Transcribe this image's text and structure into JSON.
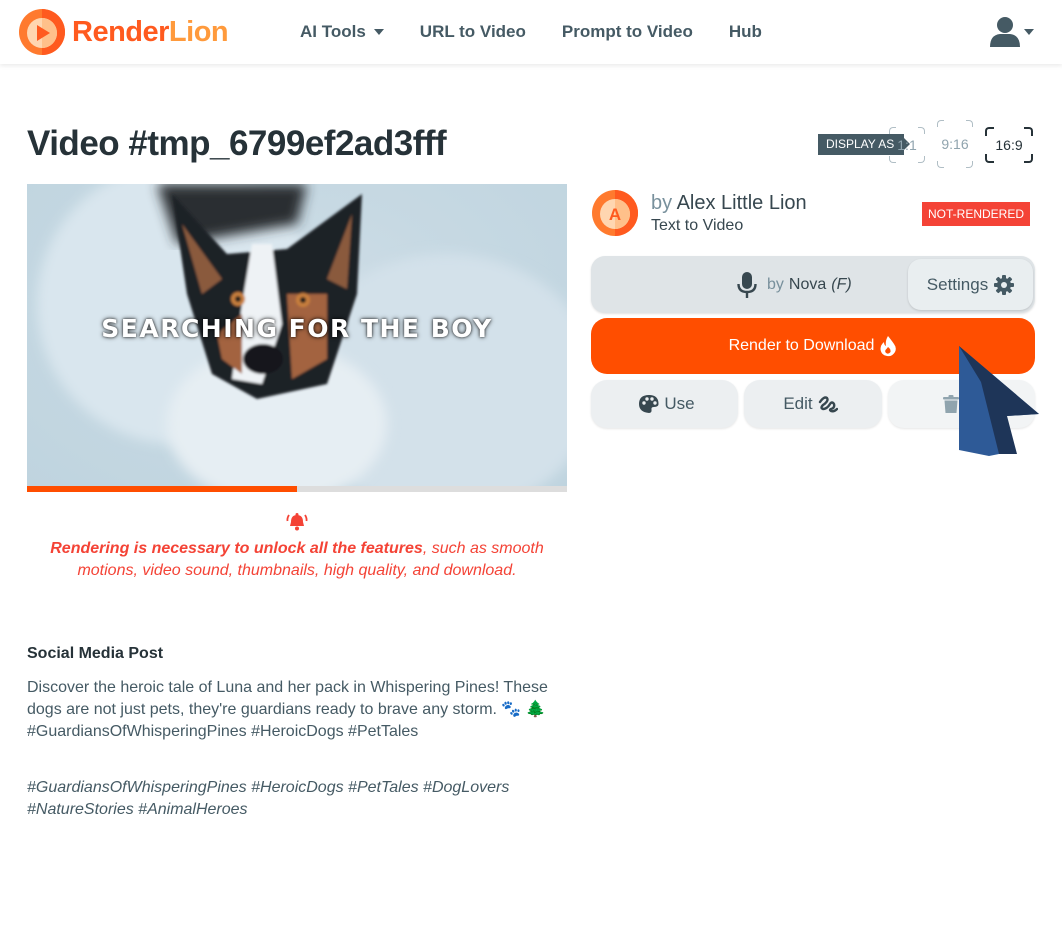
{
  "brand": {
    "name_part1": "Render",
    "name_part2": "Lion",
    "primary_color": "#ff4e00"
  },
  "nav": {
    "items": [
      {
        "label": "AI Tools",
        "has_dropdown": true
      },
      {
        "label": "URL to Video"
      },
      {
        "label": "Prompt to Video"
      },
      {
        "label": "Hub"
      }
    ],
    "user_icon": "user-icon"
  },
  "page": {
    "title": "Video #tmp_6799ef2ad3fff",
    "display_as_label": "DISPLAY AS",
    "ratios": [
      {
        "label": "1:1",
        "active": false
      },
      {
        "label": "9:16",
        "active": false
      },
      {
        "label": "16:9",
        "active": true
      }
    ]
  },
  "video": {
    "caption": "SEARCHING FOR THE BOY",
    "progress_percent": 50
  },
  "notice": {
    "icon": "bell-icon",
    "bold_text": "Rendering is necessary to unlock all the features",
    "rest_text": ", such as smooth motions, video sound, thumbnails, high quality, and download."
  },
  "social_post": {
    "heading": "Social Media Post",
    "body": "Discover the heroic tale of Luna and her pack in Whispering Pines! These dogs are not just pets, they're guardians ready to brave any storm. 🐾 🌲 #GuardiansOfWhisperingPines #HeroicDogs #PetTales",
    "tags": "#GuardiansOfWhisperingPines #HeroicDogs #PetTales #DogLovers #NatureStories #AnimalHeroes"
  },
  "author": {
    "avatar_letter": "A",
    "by_label": "by",
    "name": "Alex Little Lion",
    "type": "Text to Video",
    "status": "NOT-RENDERED",
    "status_color": "#f44336"
  },
  "voice": {
    "by_label": "by",
    "name": "Nova",
    "gender": "(F)",
    "settings_label": "Settings"
  },
  "actions": {
    "render_label": "Render to Download",
    "use_label": "Use",
    "edit_label": "Edit",
    "delete_label": "De"
  }
}
